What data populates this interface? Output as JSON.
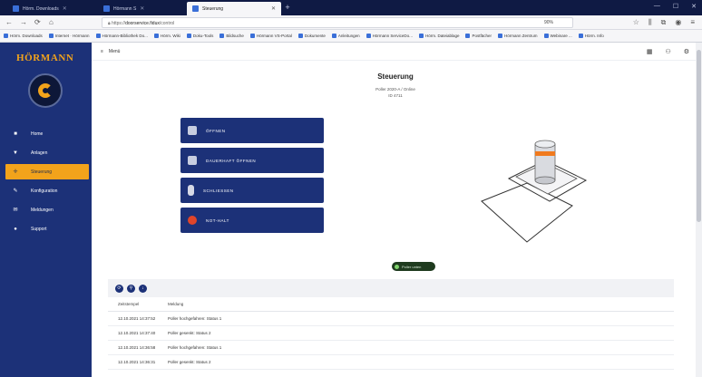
{
  "browser": {
    "tabs": [
      {
        "label": "Hörm. Downloads",
        "active": false
      },
      {
        "label": "Hörmann S",
        "active": false
      },
      {
        "label": "Steuerung",
        "active": true
      }
    ],
    "url_prefix": "https://",
    "url_host": "doorservice.fidux",
    "url_rest": "/control",
    "zoom": "90%",
    "bookmarks": [
      "Hörm. Downloads",
      "Internet · Hörmann",
      "Hörmann-Bibliothek Do...",
      "Hörm. Wiki",
      "Doku-Tools",
      "Bildsuche",
      "Hörmann VS-Portal",
      "Dokumente",
      "Anleitungen",
      "Hörmann ServiceDo...",
      "Hörm. Dateiablage",
      "Postfächer",
      "Hörmann Zentrum",
      "Webinare ...",
      "Hörm. Info"
    ]
  },
  "sidebar": {
    "brand": "HÖRMANN",
    "items": [
      {
        "label": "Home",
        "icon": "home-icon",
        "active": false
      },
      {
        "label": "Anlagen",
        "icon": "pin-icon",
        "active": false
      },
      {
        "label": "Steuerung",
        "icon": "control-icon",
        "active": true
      },
      {
        "label": "Konfiguration",
        "icon": "wrench-icon",
        "active": false
      },
      {
        "label": "Meldungen",
        "icon": "message-icon",
        "active": false
      },
      {
        "label": "Support",
        "icon": "support-icon",
        "active": false
      }
    ]
  },
  "main": {
    "breadcrumb": "Menü",
    "title": "Steuerung",
    "subtitle": "Poller 2020-A / Online",
    "subtitle2": "ID 4711",
    "actions": [
      {
        "label": "ÖFFNEN",
        "icon": "open-icon"
      },
      {
        "label": "DAUERHAFT ÖFFNEN",
        "icon": "hold-open-icon"
      },
      {
        "label": "SCHLIESSEN",
        "icon": "bollard-icon"
      },
      {
        "label": "NOT-HALT",
        "icon": "stop-icon"
      }
    ],
    "status": "Poller unten",
    "log": {
      "columns": [
        "Zeitstempel",
        "Meldung"
      ],
      "rows": [
        [
          "12.10.2021 14:37:52",
          "Poller hochgefahren: Status 1"
        ],
        [
          "12.10.2021 14:37:40",
          "Poller gesenkt: Status 2"
        ],
        [
          "12.10.2021 14:36:58",
          "Poller hochgefahren: Status 1"
        ],
        [
          "12.10.2021 14:36:31",
          "Poller gesenkt: Status 2"
        ]
      ]
    }
  },
  "colors": {
    "sidebar": "#1c3178",
    "accent": "#f2a31b",
    "action_button": "#1c3178"
  }
}
